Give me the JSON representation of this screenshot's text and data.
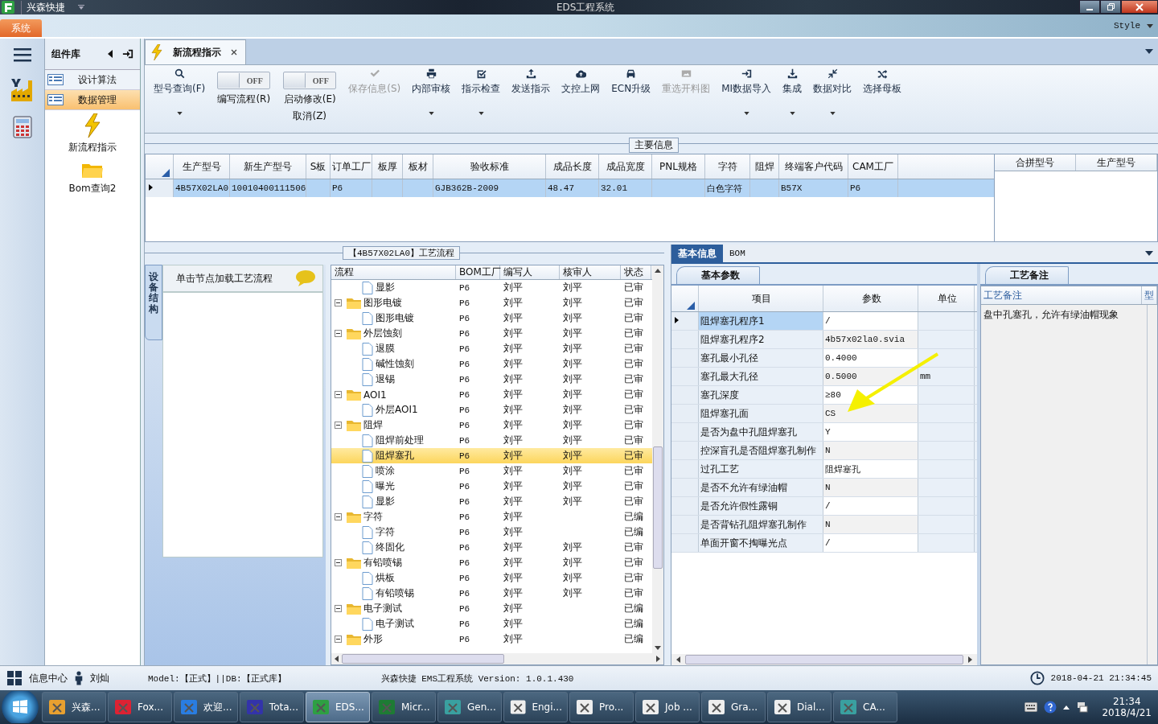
{
  "title_bar": {
    "app_name": "兴森快捷",
    "title": "EDS工程系统"
  },
  "ribbon": {
    "tabs": [
      {
        "label": "系统",
        "selected": true
      }
    ],
    "style_menu": "Style"
  },
  "component_library": {
    "title": "组件库",
    "items": [
      {
        "label": "设计算法",
        "selected": false
      },
      {
        "label": "数据管理",
        "selected": true
      }
    ],
    "tools": [
      {
        "label": "新流程指示"
      },
      {
        "label": "Bom查询2"
      }
    ]
  },
  "document_tabs": [
    {
      "label": "新流程指示",
      "selected": true
    }
  ],
  "toolbar": [
    {
      "kind": "button",
      "label": "型号查询(F)",
      "dropdown": true,
      "disabled": false
    },
    {
      "kind": "toggle",
      "toggle_text": "OFF",
      "on": false,
      "label": "编写流程(R)"
    },
    {
      "kind": "toggle",
      "toggle_text": "OFF",
      "on": false,
      "label": "启动修改(E)",
      "sublabel": "取消(Z)"
    },
    {
      "kind": "button",
      "label": "保存信息(S)",
      "dropdown": false,
      "disabled": true
    },
    {
      "kind": "button",
      "label": "内部审核",
      "dropdown": true,
      "disabled": false
    },
    {
      "kind": "button",
      "label": "指示检查",
      "dropdown": true,
      "disabled": false
    },
    {
      "kind": "button",
      "label": "发送指示",
      "dropdown": false,
      "disabled": false
    },
    {
      "kind": "button",
      "label": "文控上网",
      "dropdown": false,
      "disabled": false
    },
    {
      "kind": "button",
      "label": "ECN升级",
      "dropdown": false,
      "disabled": false
    },
    {
      "kind": "button",
      "label": "重选开料图",
      "dropdown": false,
      "disabled": true
    },
    {
      "kind": "button",
      "label": "MI数据导入",
      "dropdown": true,
      "disabled": false
    },
    {
      "kind": "button",
      "label": "集成",
      "dropdown": true,
      "disabled": false
    },
    {
      "kind": "button",
      "label": "数据对比",
      "dropdown": true,
      "disabled": false
    },
    {
      "kind": "button",
      "label": "选择母板",
      "dropdown": false,
      "disabled": false
    }
  ],
  "main_info": {
    "title": "主要信息",
    "columns": [
      "生产型号",
      "新生产型号",
      "S板",
      "订单工厂",
      "板厚",
      "板材",
      "验收标准",
      "成品长度",
      "成品宽度",
      "PNL规格",
      "字符",
      "阻焊",
      "终端客户代码",
      "CAM工厂"
    ],
    "rows": [
      {
        "selected": true,
        "cells": [
          "4B57X02LA0",
          "10010400111506",
          null,
          "P6",
          null,
          null,
          "GJB362B-2009",
          "48.47",
          "32.01",
          null,
          "白色字符",
          null,
          "B57X",
          "P6"
        ]
      }
    ],
    "side_columns": [
      "合拼型号",
      "生产型号"
    ]
  },
  "process": {
    "title": "【4B57X02LA0】工艺流程",
    "side_tab": "设备结构",
    "hint": "单击节点加载工艺流程",
    "columns": [
      "流程",
      "BOM工厂",
      "编写人",
      "核审人",
      "状态"
    ],
    "nodes": [
      {
        "children": [
          {
            "kind": "file",
            "label": "显影",
            "bom": "P6",
            "writer": "刘平",
            "reviewer": "刘平",
            "status": "已审",
            "selected": false
          }
        ]
      },
      {
        "kind": "folder",
        "label": "图形电镀",
        "bom": "P6",
        "writer": "刘平",
        "reviewer": "刘平",
        "status": "已审",
        "selected": false,
        "expanded": true,
        "children": [
          {
            "kind": "file",
            "label": "图形电镀",
            "bom": "P6",
            "writer": "刘平",
            "reviewer": "刘平",
            "status": "已审",
            "selected": false
          }
        ]
      },
      {
        "kind": "folder",
        "label": "外层蚀刻",
        "bom": "P6",
        "writer": "刘平",
        "reviewer": "刘平",
        "status": "已审",
        "selected": false,
        "expanded": true,
        "children": [
          {
            "kind": "file",
            "label": "退膜",
            "bom": "P6",
            "writer": "刘平",
            "reviewer": "刘平",
            "status": "已审",
            "selected": false
          },
          {
            "kind": "file",
            "label": "碱性蚀刻",
            "bom": "P6",
            "writer": "刘平",
            "reviewer": "刘平",
            "status": "已审",
            "selected": false
          },
          {
            "kind": "file",
            "label": "退锡",
            "bom": "P6",
            "writer": "刘平",
            "reviewer": "刘平",
            "status": "已审",
            "selected": false
          }
        ]
      },
      {
        "kind": "folder",
        "label": "AOI1",
        "bom": "P6",
        "writer": "刘平",
        "reviewer": "刘平",
        "status": "已审",
        "selected": false,
        "expanded": true,
        "children": [
          {
            "kind": "file",
            "label": "外层AOI1",
            "bom": "P6",
            "writer": "刘平",
            "reviewer": "刘平",
            "status": "已审",
            "selected": false
          }
        ]
      },
      {
        "kind": "folder",
        "label": "阻焊",
        "bom": "P6",
        "writer": "刘平",
        "reviewer": "刘平",
        "status": "已审",
        "selected": false,
        "expanded": true,
        "children": [
          {
            "kind": "file",
            "label": "阻焊前处理",
            "bom": "P6",
            "writer": "刘平",
            "reviewer": "刘平",
            "status": "已审",
            "selected": false
          },
          {
            "kind": "file",
            "label": "阻焊塞孔",
            "bom": "P6",
            "writer": "刘平",
            "reviewer": "刘平",
            "status": "已审",
            "selected": true
          },
          {
            "kind": "file",
            "label": "喷涂",
            "bom": "P6",
            "writer": "刘平",
            "reviewer": "刘平",
            "status": "已审",
            "selected": false
          },
          {
            "kind": "file",
            "label": "曝光",
            "bom": "P6",
            "writer": "刘平",
            "reviewer": "刘平",
            "status": "已审",
            "selected": false
          },
          {
            "kind": "file",
            "label": "显影",
            "bom": "P6",
            "writer": "刘平",
            "reviewer": "刘平",
            "status": "已审",
            "selected": false
          }
        ]
      },
      {
        "kind": "folder",
        "label": "字符",
        "bom": "P6",
        "writer": "刘平",
        "status": "已编",
        "selected": false,
        "expanded": true,
        "children": [
          {
            "kind": "file",
            "label": "字符",
            "bom": "P6",
            "writer": "刘平",
            "status": "已编",
            "selected": false
          },
          {
            "kind": "file",
            "label": "终固化",
            "bom": "P6",
            "writer": "刘平",
            "reviewer": "刘平",
            "status": "已审",
            "selected": false
          }
        ]
      },
      {
        "kind": "folder",
        "label": "有铅喷锡",
        "bom": "P6",
        "writer": "刘平",
        "reviewer": "刘平",
        "status": "已审",
        "selected": false,
        "expanded": true,
        "children": [
          {
            "kind": "file",
            "label": "烘板",
            "bom": "P6",
            "writer": "刘平",
            "reviewer": "刘平",
            "status": "已审",
            "selected": false
          },
          {
            "kind": "file",
            "label": "有铅喷锡",
            "bom": "P6",
            "writer": "刘平",
            "reviewer": "刘平",
            "status": "已审",
            "selected": false
          }
        ]
      },
      {
        "kind": "folder",
        "label": "电子测试",
        "bom": "P6",
        "writer": "刘平",
        "status": "已编",
        "selected": false,
        "expanded": true,
        "children": [
          {
            "kind": "file",
            "label": "电子测试",
            "bom": "P6",
            "writer": "刘平",
            "status": "已编",
            "selected": false
          }
        ]
      },
      {
        "kind": "folder",
        "label": "外形",
        "bom": "P6",
        "writer": "刘平",
        "status": "已编",
        "selected": false,
        "expanded": true
      }
    ]
  },
  "details": {
    "tabs": [
      {
        "label": "基本信息",
        "selected": true
      },
      {
        "label": "BOM",
        "selected": false
      }
    ],
    "params_tab": "基本参数",
    "columns": [
      "项目",
      "参数",
      "单位"
    ],
    "rows": [
      {
        "item": "阻焊塞孔程序1",
        "value": "/",
        "selected": true
      },
      {
        "item": "阻焊塞孔程序2",
        "value": "4b57x02la0.svia",
        "selected": false
      },
      {
        "item": "塞孔最小孔径",
        "value": "0.4000",
        "selected": false
      },
      {
        "item": "塞孔最大孔径",
        "value": "0.5000",
        "unit": "mm",
        "selected": false
      },
      {
        "item": "塞孔深度",
        "value": "≥80",
        "selected": false
      },
      {
        "item": "阻焊塞孔面",
        "value": "CS",
        "selected": false
      },
      {
        "item": "是否为盘中孔阻焊塞孔",
        "value": "Y",
        "selected": false
      },
      {
        "item": "控深盲孔是否阻焊塞孔制作",
        "value": "N",
        "selected": false
      },
      {
        "item": "过孔工艺",
        "value": "阻焊塞孔",
        "selected": false
      },
      {
        "item": "是否不允许有绿油帽",
        "value": "N",
        "selected": false
      },
      {
        "item": "是否允许假性露铜",
        "value": "/",
        "selected": false
      },
      {
        "item": "是否背钻孔阻焊塞孔制作",
        "value": "N",
        "selected": false
      },
      {
        "item": "单面开窗不掏曝光点",
        "value": "/",
        "selected": false
      }
    ],
    "notes_tab": "工艺备注",
    "notes_columns": [
      "工艺备注",
      "型"
    ],
    "notes": [
      "盘中孔塞孔，允许有绿油帽现象"
    ]
  },
  "status_bar": {
    "info_center": "信息中心",
    "user": "刘灿",
    "model": "Model:【正式】||DB:【正式库】",
    "version": "兴森快捷 EMS工程系统 Version: 1.0.1.430",
    "datetime": "2018-04-21 21:34:45"
  },
  "taskbar": {
    "items": [
      {
        "label": "兴森...",
        "selected": false
      },
      {
        "label": "Fox...",
        "selected": false
      },
      {
        "label": "欢迎...",
        "selected": false
      },
      {
        "label": "Tota...",
        "selected": false
      },
      {
        "label": "EDS...",
        "selected": true
      },
      {
        "label": "Micr...",
        "selected": false
      },
      {
        "label": "Gen...",
        "selected": false
      },
      {
        "label": "Engi...",
        "selected": false
      },
      {
        "label": "Pro...",
        "selected": false
      },
      {
        "label": "Job ...",
        "selected": false
      },
      {
        "label": "Gra...",
        "selected": false
      },
      {
        "label": "Dial...",
        "selected": false
      },
      {
        "label": "CA...",
        "selected": false
      }
    ],
    "time": "21:34",
    "date": "2018/4/21"
  }
}
